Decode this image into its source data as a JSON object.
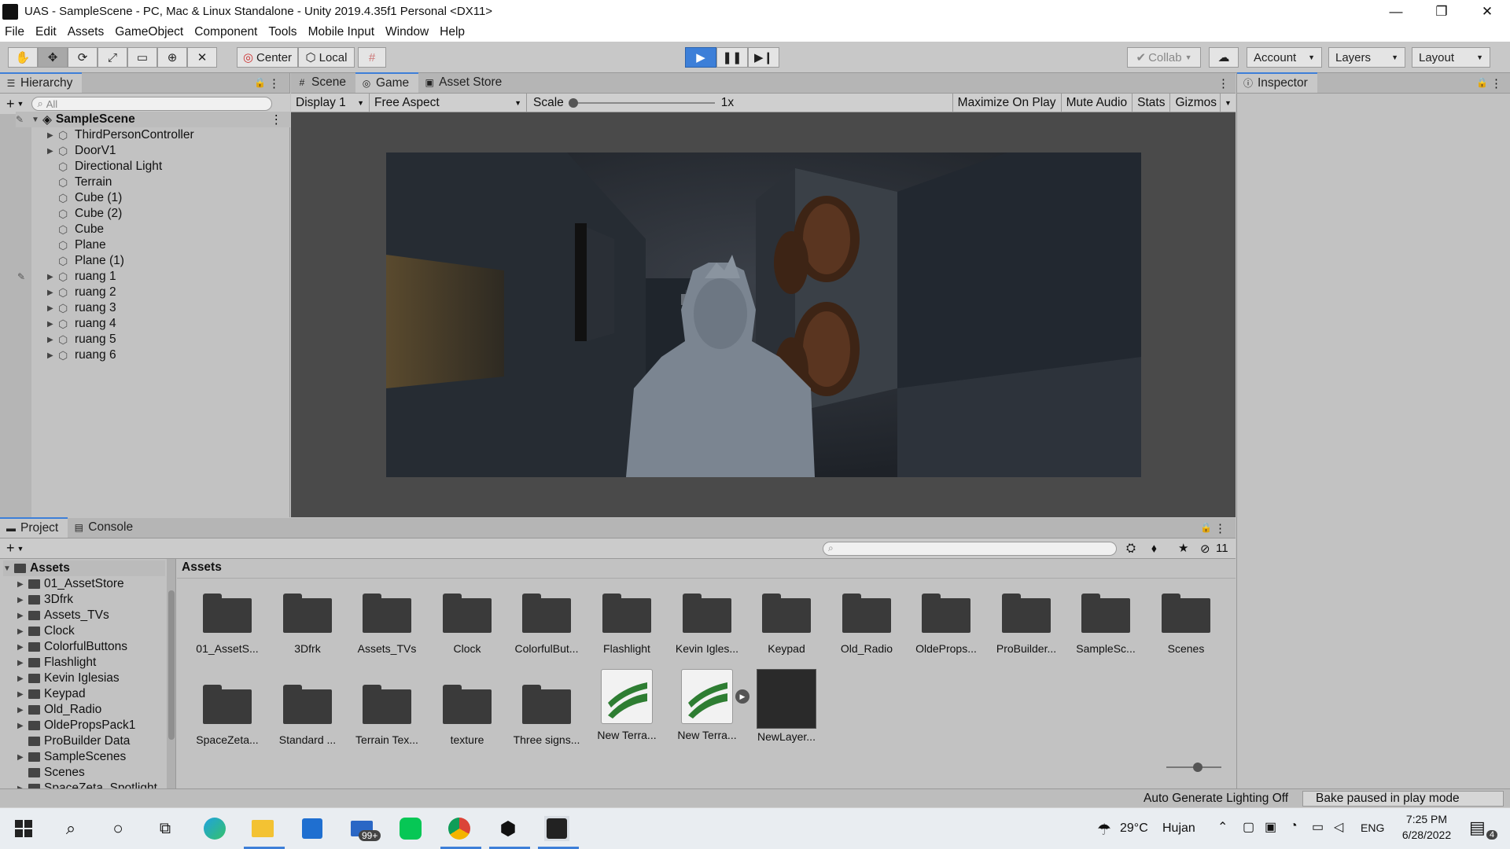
{
  "window": {
    "title": "UAS - SampleScene - PC, Mac & Linux Standalone - Unity 2019.4.35f1 Personal <DX11>",
    "minimize": "—",
    "restore": "❐",
    "close": "✕"
  },
  "menu": [
    "File",
    "Edit",
    "Assets",
    "GameObject",
    "Component",
    "Tools",
    "Mobile Input",
    "Window",
    "Help"
  ],
  "toolbar": {
    "center": "Center",
    "local": "Local",
    "collab": "Collab",
    "account": "Account",
    "layers": "Layers",
    "layout": "Layout"
  },
  "hierarchy": {
    "tab": "Hierarchy",
    "search_placeholder": "All",
    "scene": "SampleScene",
    "items": [
      "ThirdPersonController",
      "DoorV1",
      "Directional Light",
      "Terrain",
      "Cube (1)",
      "Cube (2)",
      "Cube",
      "Plane",
      "Plane (1)",
      "ruang 1",
      "ruang 2",
      "ruang 3",
      "ruang 4",
      "ruang 5",
      "ruang 6"
    ]
  },
  "center_tabs": {
    "scene": "Scene",
    "game": "Game",
    "asset_store": "Asset Store"
  },
  "gamebar": {
    "display": "Display 1",
    "aspect": "Free Aspect",
    "scale_label": "Scale",
    "scale_value": "1x",
    "maximize": "Maximize On Play",
    "mute": "Mute Audio",
    "stats": "Stats",
    "gizmos": "Gizmos"
  },
  "inspector": {
    "tab": "Inspector"
  },
  "project": {
    "tab_project": "Project",
    "tab_console": "Console",
    "hidden_count": "11",
    "tree_root": "Assets",
    "tree": [
      "01_AssetStore",
      "3Dfrk",
      "Assets_TVs",
      "Clock",
      "ColorfulButtons",
      "Flashlight",
      "Kevin Iglesias",
      "Keypad",
      "Old_Radio",
      "OldePropsPack1",
      "ProBuilder Data",
      "SampleScenes",
      "Scenes",
      "SpaceZeta_Spotlight"
    ],
    "breadcrumb": "Assets",
    "assets": [
      "01_AssetS...",
      "3Dfrk",
      "Assets_TVs",
      "Clock",
      "ColorfulBut...",
      "Flashlight",
      "Kevin Igles...",
      "Keypad",
      "Old_Radio",
      "OldeProps...",
      "ProBuilder...",
      "SampleSc...",
      "Scenes",
      "SpaceZeta...",
      "Standard ...",
      "Terrain Tex...",
      "texture",
      "Three signs...",
      "New Terra...",
      "New Terra...",
      "NewLayer..."
    ]
  },
  "status": {
    "auto_lighting": "Auto Generate Lighting Off",
    "bake": "Bake paused in play mode"
  },
  "taskbar": {
    "weather_temp": "29°C",
    "weather_text": "Hujan",
    "lang": "ENG",
    "time": "7:25 PM",
    "date": "6/28/2022",
    "mail_badge": "99+",
    "notif_count": "4"
  }
}
